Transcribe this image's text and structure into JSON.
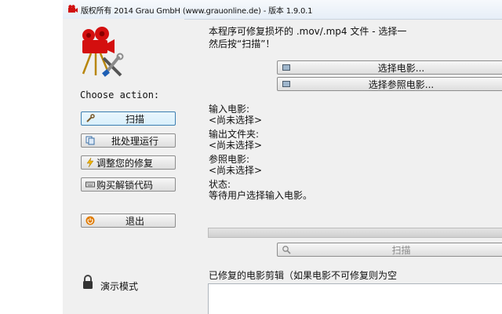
{
  "window": {
    "title": "版权所有 2014 Grau GmbH (www.grauonline.de) - 版本 1.9.0.1"
  },
  "sidebar": {
    "choose_label": "Choose action:",
    "buttons": {
      "scan": "扫描",
      "batch": "批处理运行",
      "tune": "调整您的修复",
      "buy": "购买解锁代码",
      "exit": "退出"
    },
    "demo_mode": "演示模式"
  },
  "main": {
    "intro_line1": "本程序可修复损坏的 .mov/.mp4 文件 - 选择一",
    "intro_line2": "然后按“扫描”！",
    "select_movie_button": "选择电影...",
    "select_reference_button": "选择参照电影...",
    "input_movie_label": "输入电影:",
    "input_movie_value": "<尚未选择>",
    "output_folder_label": "输出文件夹:",
    "output_folder_value": "<尚未选择>",
    "reference_movie_label": "参照电影:",
    "reference_movie_value": "<尚未选择>",
    "status_label": "状态:",
    "status_value": "等待用户选择输入电影。",
    "progress": 0,
    "scan_button": "扫描",
    "repaired_clips_label": "已修复的电影剪辑（如果电影不可修复则为空"
  }
}
